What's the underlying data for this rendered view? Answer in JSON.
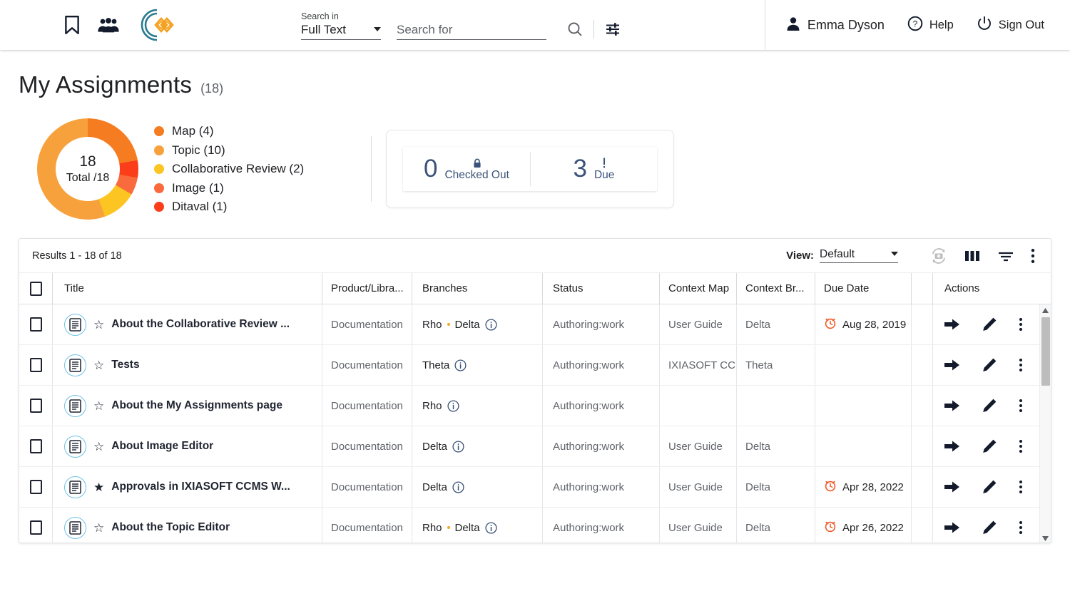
{
  "topbar": {
    "menu_icon": "hamburger-menu-icon",
    "bookmark_icon": "bookmark-icon",
    "people_icon": "people-icon",
    "logo_icon": "ixiasoft-logo-icon",
    "search_in_label": "Search in",
    "search_in_value": "Full Text",
    "search_placeholder": "Search for",
    "search_value": "",
    "search_icon": "search-icon",
    "advanced_search_icon": "tune-sliders-icon",
    "user_name": "Emma Dyson",
    "user_icon": "person-icon",
    "help_label": "Help",
    "help_icon": "help-circle-icon",
    "signout_label": "Sign Out",
    "signout_icon": "power-icon"
  },
  "page": {
    "title": "My Assignments",
    "count": "(18)"
  },
  "chart_data": {
    "type": "pie",
    "title": "My Assignments",
    "center_value": "18",
    "center_label": "Total /18",
    "total": 18,
    "legend_position": "right",
    "categories": [
      "Map",
      "Topic",
      "Collaborative Review",
      "Image",
      "Ditaval"
    ],
    "values": [
      4,
      10,
      2,
      1,
      1
    ],
    "colors": [
      "#f57c20",
      "#f7a13c",
      "#fcc521",
      "#f96a3c",
      "#fb3d1a"
    ],
    "legend": [
      {
        "label": "Map (4)",
        "color": "#f57c20",
        "value": 4
      },
      {
        "label": "Topic (10)",
        "color": "#f7a13c",
        "value": 10
      },
      {
        "label": "Collaborative Review (2)",
        "color": "#fcc521",
        "value": 2
      },
      {
        "label": "Image (1)",
        "color": "#f96a3c",
        "value": 1
      },
      {
        "label": "Ditaval (1)",
        "color": "#fb3d1a",
        "value": 1
      }
    ]
  },
  "stats": [
    {
      "number": "0",
      "label": "Checked Out",
      "icon": "lock-icon"
    },
    {
      "number": "3",
      "label": "Due",
      "icon": "exclamation-icon"
    }
  ],
  "results": {
    "count_text": "Results 1 - 18 of 18",
    "view_label": "View:",
    "view_value": "Default",
    "refresh_icon": "refresh-camera-icon",
    "columns_icon": "columns-icon",
    "filter_icon": "filter-icon",
    "more_icon": "more-vertical-icon"
  },
  "table": {
    "columns": [
      "Title",
      "Product/Libra...",
      "Branches",
      "Status",
      "Context Map",
      "Context Br...",
      "Due Date",
      "Actions"
    ],
    "rows": [
      {
        "title": "About the Collaborative Review ...",
        "starred": false,
        "product": "Documentation",
        "branches": [
          "Rho",
          "Delta"
        ],
        "status": "Authoring:work",
        "context_map": "User Guide",
        "context_branch": "Delta",
        "due_date": "Aug 28, 2019",
        "has_due": true
      },
      {
        "title": "Tests",
        "starred": false,
        "product": "Documentation",
        "branches": [
          "Theta"
        ],
        "status": "Authoring:work",
        "context_map": "IXIASOFT CC",
        "context_branch": "Theta",
        "due_date": "",
        "has_due": false
      },
      {
        "title": "About the My Assignments page",
        "starred": false,
        "product": "Documentation",
        "branches": [
          "Rho"
        ],
        "status": "Authoring:work",
        "context_map": "",
        "context_branch": "",
        "due_date": "",
        "has_due": false
      },
      {
        "title": "About Image Editor",
        "starred": false,
        "product": "Documentation",
        "branches": [
          "Delta"
        ],
        "status": "Authoring:work",
        "context_map": "User Guide",
        "context_branch": "Delta",
        "due_date": "",
        "has_due": false
      },
      {
        "title": "Approvals in IXIASOFT CCMS W...",
        "starred": true,
        "product": "Documentation",
        "branches": [
          "Delta"
        ],
        "status": "Authoring:work",
        "context_map": "User Guide",
        "context_branch": "Delta",
        "due_date": "Apr 28, 2022",
        "has_due": true
      },
      {
        "title": "About the Topic Editor",
        "starred": false,
        "product": "Documentation",
        "branches": [
          "Rho",
          "Delta"
        ],
        "status": "Authoring:work",
        "context_map": "User Guide",
        "context_branch": "Delta",
        "due_date": "Apr 26, 2022",
        "has_due": true
      }
    ],
    "row_icons": {
      "doc_icon": "document-icon",
      "star_icon": "star-icon",
      "info_icon": "info-circle-icon",
      "open_icon": "arrow-right-icon",
      "edit_icon": "pencil-icon",
      "more_icon": "more-vertical-icon",
      "due_icon": "alarm-clock-icon"
    }
  },
  "colors": {
    "accent_orange": "#f57c20",
    "accent_teal": "#2b7b91",
    "due_red": "#f05a28",
    "stat_blue": "#3b5379"
  }
}
